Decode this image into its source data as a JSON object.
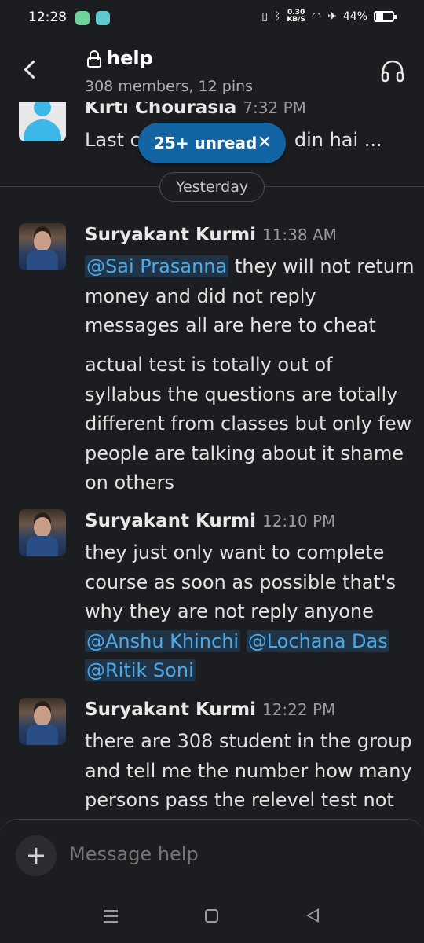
{
  "status_bar": {
    "time": "12:28",
    "net_speed_value": "0.30",
    "net_speed_unit": "KB/S",
    "battery": "44%",
    "battery_level": 0.44
  },
  "header": {
    "channel_name": "help",
    "subtitle": "308 members, 12 pins"
  },
  "unread_pill": {
    "label": "25+ unread",
    "close": "✕"
  },
  "partial_message": {
    "author": "Kirti Chourasia",
    "time": "7:32 PM",
    "text_start": "Last c",
    "text_end": "din hai ..."
  },
  "divider": {
    "label": "Yesterday"
  },
  "messages": [
    {
      "author": "Suryakant Kurmi",
      "time": "11:38 AM",
      "mention": "@Sai Prasanna",
      "text": " they will not return money and did not reply messages all are here to cheat",
      "text2": "actual test is totally out of syllabus the  questions are totally different from classes but only few people are talking about it shame on others"
    },
    {
      "author": "Suryakant Kurmi",
      "time": "12:10 PM",
      "text": "they just only want to complete course as soon as possible that's why they are not reply anyone ",
      "mentions": [
        "@Anshu Khinchi",
        "@Lochana Das",
        "@Ritik Soni"
      ]
    },
    {
      "author": "Suryakant Kurmi",
      "time": "12:22 PM",
      "text": "there are 308 student in the group and tell me the number how many persons pass the relevel test not"
    }
  ],
  "composer": {
    "placeholder": "Message help",
    "add": "+"
  }
}
